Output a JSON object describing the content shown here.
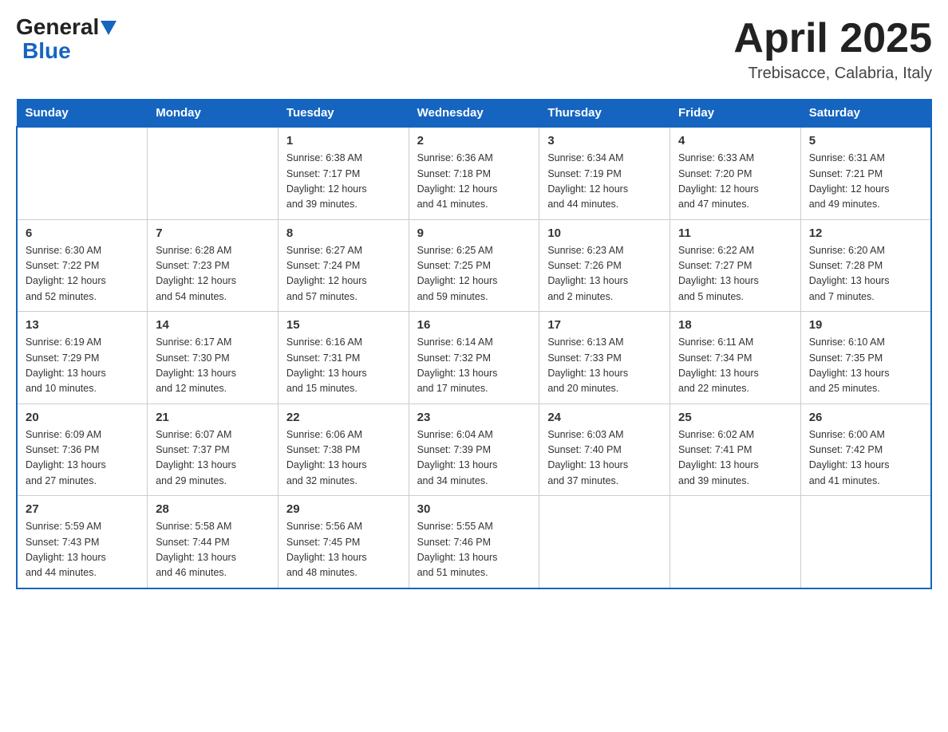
{
  "header": {
    "logo_general": "General",
    "logo_blue": "Blue",
    "month_title": "April 2025",
    "location": "Trebisacce, Calabria, Italy"
  },
  "days_of_week": [
    "Sunday",
    "Monday",
    "Tuesday",
    "Wednesday",
    "Thursday",
    "Friday",
    "Saturday"
  ],
  "weeks": [
    [
      {
        "day": "",
        "info": ""
      },
      {
        "day": "",
        "info": ""
      },
      {
        "day": "1",
        "info": "Sunrise: 6:38 AM\nSunset: 7:17 PM\nDaylight: 12 hours\nand 39 minutes."
      },
      {
        "day": "2",
        "info": "Sunrise: 6:36 AM\nSunset: 7:18 PM\nDaylight: 12 hours\nand 41 minutes."
      },
      {
        "day": "3",
        "info": "Sunrise: 6:34 AM\nSunset: 7:19 PM\nDaylight: 12 hours\nand 44 minutes."
      },
      {
        "day": "4",
        "info": "Sunrise: 6:33 AM\nSunset: 7:20 PM\nDaylight: 12 hours\nand 47 minutes."
      },
      {
        "day": "5",
        "info": "Sunrise: 6:31 AM\nSunset: 7:21 PM\nDaylight: 12 hours\nand 49 minutes."
      }
    ],
    [
      {
        "day": "6",
        "info": "Sunrise: 6:30 AM\nSunset: 7:22 PM\nDaylight: 12 hours\nand 52 minutes."
      },
      {
        "day": "7",
        "info": "Sunrise: 6:28 AM\nSunset: 7:23 PM\nDaylight: 12 hours\nand 54 minutes."
      },
      {
        "day": "8",
        "info": "Sunrise: 6:27 AM\nSunset: 7:24 PM\nDaylight: 12 hours\nand 57 minutes."
      },
      {
        "day": "9",
        "info": "Sunrise: 6:25 AM\nSunset: 7:25 PM\nDaylight: 12 hours\nand 59 minutes."
      },
      {
        "day": "10",
        "info": "Sunrise: 6:23 AM\nSunset: 7:26 PM\nDaylight: 13 hours\nand 2 minutes."
      },
      {
        "day": "11",
        "info": "Sunrise: 6:22 AM\nSunset: 7:27 PM\nDaylight: 13 hours\nand 5 minutes."
      },
      {
        "day": "12",
        "info": "Sunrise: 6:20 AM\nSunset: 7:28 PM\nDaylight: 13 hours\nand 7 minutes."
      }
    ],
    [
      {
        "day": "13",
        "info": "Sunrise: 6:19 AM\nSunset: 7:29 PM\nDaylight: 13 hours\nand 10 minutes."
      },
      {
        "day": "14",
        "info": "Sunrise: 6:17 AM\nSunset: 7:30 PM\nDaylight: 13 hours\nand 12 minutes."
      },
      {
        "day": "15",
        "info": "Sunrise: 6:16 AM\nSunset: 7:31 PM\nDaylight: 13 hours\nand 15 minutes."
      },
      {
        "day": "16",
        "info": "Sunrise: 6:14 AM\nSunset: 7:32 PM\nDaylight: 13 hours\nand 17 minutes."
      },
      {
        "day": "17",
        "info": "Sunrise: 6:13 AM\nSunset: 7:33 PM\nDaylight: 13 hours\nand 20 minutes."
      },
      {
        "day": "18",
        "info": "Sunrise: 6:11 AM\nSunset: 7:34 PM\nDaylight: 13 hours\nand 22 minutes."
      },
      {
        "day": "19",
        "info": "Sunrise: 6:10 AM\nSunset: 7:35 PM\nDaylight: 13 hours\nand 25 minutes."
      }
    ],
    [
      {
        "day": "20",
        "info": "Sunrise: 6:09 AM\nSunset: 7:36 PM\nDaylight: 13 hours\nand 27 minutes."
      },
      {
        "day": "21",
        "info": "Sunrise: 6:07 AM\nSunset: 7:37 PM\nDaylight: 13 hours\nand 29 minutes."
      },
      {
        "day": "22",
        "info": "Sunrise: 6:06 AM\nSunset: 7:38 PM\nDaylight: 13 hours\nand 32 minutes."
      },
      {
        "day": "23",
        "info": "Sunrise: 6:04 AM\nSunset: 7:39 PM\nDaylight: 13 hours\nand 34 minutes."
      },
      {
        "day": "24",
        "info": "Sunrise: 6:03 AM\nSunset: 7:40 PM\nDaylight: 13 hours\nand 37 minutes."
      },
      {
        "day": "25",
        "info": "Sunrise: 6:02 AM\nSunset: 7:41 PM\nDaylight: 13 hours\nand 39 minutes."
      },
      {
        "day": "26",
        "info": "Sunrise: 6:00 AM\nSunset: 7:42 PM\nDaylight: 13 hours\nand 41 minutes."
      }
    ],
    [
      {
        "day": "27",
        "info": "Sunrise: 5:59 AM\nSunset: 7:43 PM\nDaylight: 13 hours\nand 44 minutes."
      },
      {
        "day": "28",
        "info": "Sunrise: 5:58 AM\nSunset: 7:44 PM\nDaylight: 13 hours\nand 46 minutes."
      },
      {
        "day": "29",
        "info": "Sunrise: 5:56 AM\nSunset: 7:45 PM\nDaylight: 13 hours\nand 48 minutes."
      },
      {
        "day": "30",
        "info": "Sunrise: 5:55 AM\nSunset: 7:46 PM\nDaylight: 13 hours\nand 51 minutes."
      },
      {
        "day": "",
        "info": ""
      },
      {
        "day": "",
        "info": ""
      },
      {
        "day": "",
        "info": ""
      }
    ]
  ]
}
